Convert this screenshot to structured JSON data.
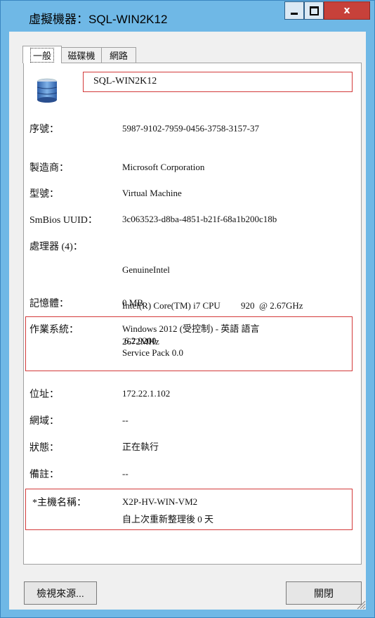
{
  "window": {
    "title": "虛擬機器：SQL-WIN2K12",
    "close_glyph": "x"
  },
  "tabs": [
    {
      "label": "一般",
      "active": true
    },
    {
      "label": "磁碟機",
      "active": false
    },
    {
      "label": "網路",
      "active": false
    }
  ],
  "vm": {
    "icon": "server-icon",
    "name": "SQL-WIN2K12"
  },
  "fields": {
    "serial": {
      "label": "序號：",
      "value": "5987-9102-7959-0456-3758-3157-37"
    },
    "manufacturer": {
      "label": "製造商：",
      "value": "Microsoft Corporation"
    },
    "model": {
      "label": "型號：",
      "value": "Virtual Machine"
    },
    "smbios": {
      "label": "SmBios UUID：",
      "value": "3c063523-d8ba-4851-b21f-68a1b200c18b"
    },
    "processor": {
      "label": "處理器 (4)：",
      "lines": [
        "GenuineIntel",
        "Intel(R) Core(TM) i7 CPU         920  @ 2.67GHz",
        "2672MHz"
      ]
    },
    "memory": {
      "label": "記憶體：",
      "value": "0 MB"
    },
    "os": {
      "label": "作業系統：",
      "lines": [
        "Windows 2012 (受控制)  - 英語 語言",
        "6.2.9200",
        "Service Pack 0.0"
      ]
    },
    "address": {
      "label": "位址：",
      "value": "172.22.1.102"
    },
    "domain": {
      "label": "網域：",
      "value": "--"
    },
    "status": {
      "label": "狀態：",
      "value": "正在執行"
    },
    "notes": {
      "label": "備註：",
      "value": "--"
    },
    "hostname": {
      "label": "*主機名稱：",
      "value": "X2P-HV-WIN-VM2",
      "uptime": "自上次重新整理後 0 天"
    }
  },
  "buttons": {
    "view_source": "檢視來源...",
    "close": "關閉"
  },
  "colors": {
    "title_bar": "#6fb8e6",
    "highlight_box": "#d33a3a",
    "close_button": "#c7413a"
  }
}
